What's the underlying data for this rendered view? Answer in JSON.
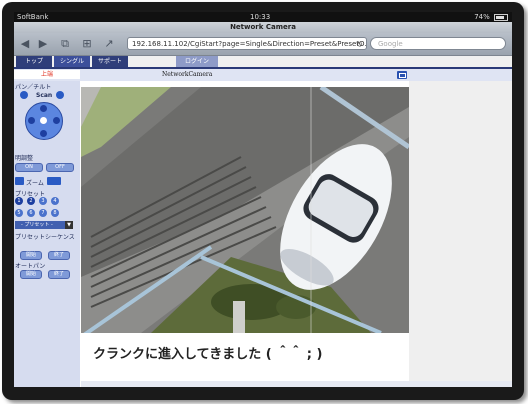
{
  "status": {
    "carrier": "SoftBank",
    "time": "10:33",
    "battery": "74%"
  },
  "browser": {
    "title": "Network Camera",
    "url": "192.168.11.102/CgiStart?page=Single&Direction=Preset&PresetO…",
    "search_placeholder": "Google"
  },
  "nav": {
    "tabs": [
      "トップ",
      "シングル",
      "サポート",
      "ログイン"
    ],
    "active_tab": "シングル"
  },
  "header": {
    "up_button": "上端",
    "page_title": "NetworkCamera"
  },
  "panel": {
    "pan_tilt_label": "パン／チルト",
    "scan_label": "Scan",
    "brightness_label": "明調整",
    "on_label": "ON",
    "off_label": "OFF",
    "zoom_label": "ズーム",
    "preset_label": "プリセット",
    "preset_numbers": [
      "1",
      "2",
      "3",
      "4",
      "5",
      "6",
      "7",
      "8"
    ],
    "preset_select": "- プリセット -",
    "preset_sequence_label": "プリセットシーケンス",
    "start_label": "開始",
    "stop_label": "終了",
    "autopan_label": "オートパン"
  },
  "camera": {
    "caption": "クランクに進入してきました ( ＾＾ ; )"
  }
}
